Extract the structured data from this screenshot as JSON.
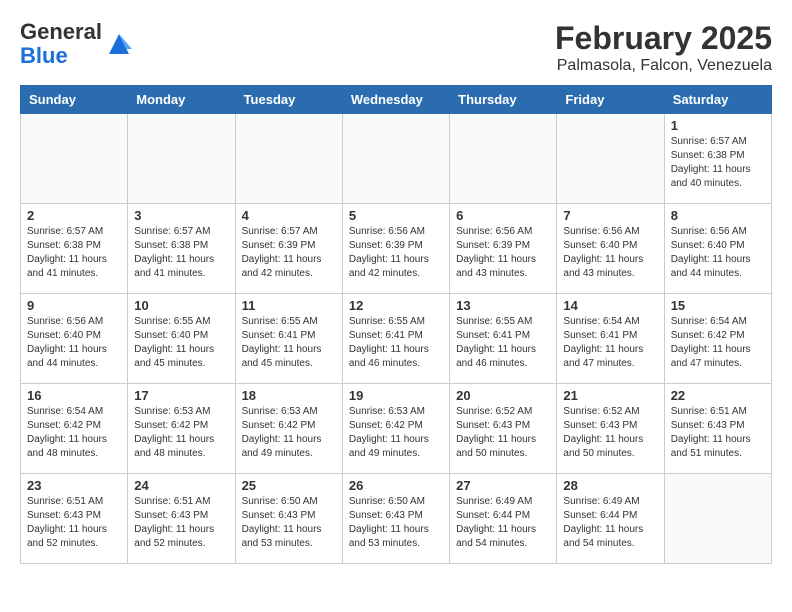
{
  "header": {
    "logo_general": "General",
    "logo_blue": "Blue",
    "month_title": "February 2025",
    "location": "Palmasola, Falcon, Venezuela"
  },
  "days_of_week": [
    "Sunday",
    "Monday",
    "Tuesday",
    "Wednesday",
    "Thursday",
    "Friday",
    "Saturday"
  ],
  "weeks": [
    [
      {
        "day": "",
        "info": ""
      },
      {
        "day": "",
        "info": ""
      },
      {
        "day": "",
        "info": ""
      },
      {
        "day": "",
        "info": ""
      },
      {
        "day": "",
        "info": ""
      },
      {
        "day": "",
        "info": ""
      },
      {
        "day": "1",
        "info": "Sunrise: 6:57 AM\nSunset: 6:38 PM\nDaylight: 11 hours\nand 40 minutes."
      }
    ],
    [
      {
        "day": "2",
        "info": "Sunrise: 6:57 AM\nSunset: 6:38 PM\nDaylight: 11 hours\nand 41 minutes."
      },
      {
        "day": "3",
        "info": "Sunrise: 6:57 AM\nSunset: 6:38 PM\nDaylight: 11 hours\nand 41 minutes."
      },
      {
        "day": "4",
        "info": "Sunrise: 6:57 AM\nSunset: 6:39 PM\nDaylight: 11 hours\nand 42 minutes."
      },
      {
        "day": "5",
        "info": "Sunrise: 6:56 AM\nSunset: 6:39 PM\nDaylight: 11 hours\nand 42 minutes."
      },
      {
        "day": "6",
        "info": "Sunrise: 6:56 AM\nSunset: 6:39 PM\nDaylight: 11 hours\nand 43 minutes."
      },
      {
        "day": "7",
        "info": "Sunrise: 6:56 AM\nSunset: 6:40 PM\nDaylight: 11 hours\nand 43 minutes."
      },
      {
        "day": "8",
        "info": "Sunrise: 6:56 AM\nSunset: 6:40 PM\nDaylight: 11 hours\nand 44 minutes."
      }
    ],
    [
      {
        "day": "9",
        "info": "Sunrise: 6:56 AM\nSunset: 6:40 PM\nDaylight: 11 hours\nand 44 minutes."
      },
      {
        "day": "10",
        "info": "Sunrise: 6:55 AM\nSunset: 6:40 PM\nDaylight: 11 hours\nand 45 minutes."
      },
      {
        "day": "11",
        "info": "Sunrise: 6:55 AM\nSunset: 6:41 PM\nDaylight: 11 hours\nand 45 minutes."
      },
      {
        "day": "12",
        "info": "Sunrise: 6:55 AM\nSunset: 6:41 PM\nDaylight: 11 hours\nand 46 minutes."
      },
      {
        "day": "13",
        "info": "Sunrise: 6:55 AM\nSunset: 6:41 PM\nDaylight: 11 hours\nand 46 minutes."
      },
      {
        "day": "14",
        "info": "Sunrise: 6:54 AM\nSunset: 6:41 PM\nDaylight: 11 hours\nand 47 minutes."
      },
      {
        "day": "15",
        "info": "Sunrise: 6:54 AM\nSunset: 6:42 PM\nDaylight: 11 hours\nand 47 minutes."
      }
    ],
    [
      {
        "day": "16",
        "info": "Sunrise: 6:54 AM\nSunset: 6:42 PM\nDaylight: 11 hours\nand 48 minutes."
      },
      {
        "day": "17",
        "info": "Sunrise: 6:53 AM\nSunset: 6:42 PM\nDaylight: 11 hours\nand 48 minutes."
      },
      {
        "day": "18",
        "info": "Sunrise: 6:53 AM\nSunset: 6:42 PM\nDaylight: 11 hours\nand 49 minutes."
      },
      {
        "day": "19",
        "info": "Sunrise: 6:53 AM\nSunset: 6:42 PM\nDaylight: 11 hours\nand 49 minutes."
      },
      {
        "day": "20",
        "info": "Sunrise: 6:52 AM\nSunset: 6:43 PM\nDaylight: 11 hours\nand 50 minutes."
      },
      {
        "day": "21",
        "info": "Sunrise: 6:52 AM\nSunset: 6:43 PM\nDaylight: 11 hours\nand 50 minutes."
      },
      {
        "day": "22",
        "info": "Sunrise: 6:51 AM\nSunset: 6:43 PM\nDaylight: 11 hours\nand 51 minutes."
      }
    ],
    [
      {
        "day": "23",
        "info": "Sunrise: 6:51 AM\nSunset: 6:43 PM\nDaylight: 11 hours\nand 52 minutes."
      },
      {
        "day": "24",
        "info": "Sunrise: 6:51 AM\nSunset: 6:43 PM\nDaylight: 11 hours\nand 52 minutes."
      },
      {
        "day": "25",
        "info": "Sunrise: 6:50 AM\nSunset: 6:43 PM\nDaylight: 11 hours\nand 53 minutes."
      },
      {
        "day": "26",
        "info": "Sunrise: 6:50 AM\nSunset: 6:43 PM\nDaylight: 11 hours\nand 53 minutes."
      },
      {
        "day": "27",
        "info": "Sunrise: 6:49 AM\nSunset: 6:44 PM\nDaylight: 11 hours\nand 54 minutes."
      },
      {
        "day": "28",
        "info": "Sunrise: 6:49 AM\nSunset: 6:44 PM\nDaylight: 11 hours\nand 54 minutes."
      },
      {
        "day": "",
        "info": ""
      }
    ]
  ]
}
